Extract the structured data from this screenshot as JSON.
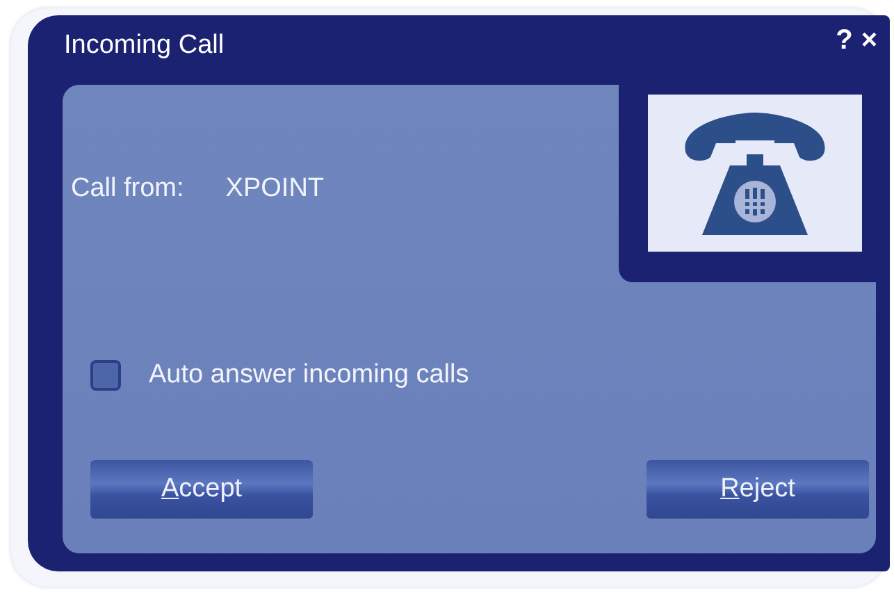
{
  "window": {
    "title": "Incoming Call",
    "help": "?",
    "close": "×"
  },
  "caller": {
    "label": "Call from:",
    "value": "XPOINT"
  },
  "auto_answer": {
    "label": "Auto answer incoming calls",
    "checked": false
  },
  "buttons": [
    {
      "label": "Accept",
      "mnemonic": true
    },
    {
      "label": "Reject",
      "mnemonic": true
    }
  ]
}
